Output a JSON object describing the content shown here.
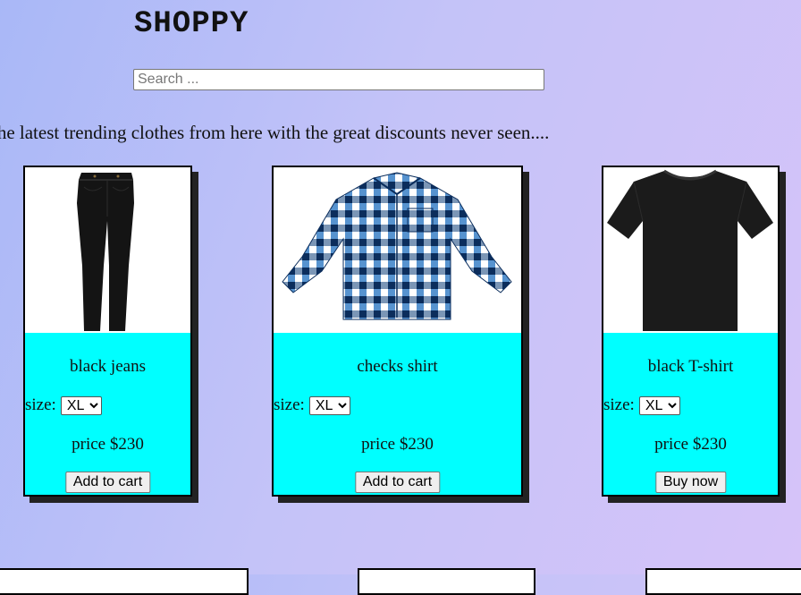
{
  "header": {
    "brand": "SHOPPY",
    "search_placeholder": "Search ...",
    "tagline": "the latest trending clothes from here with the great discounts never seen...."
  },
  "products": [
    {
      "name": "black jeans",
      "size_label": "size:",
      "size_options": [
        "XL"
      ],
      "size_selected": "XL",
      "price": "price $230",
      "button_label": "Add to cart",
      "image_icon": "black-jeans-image"
    },
    {
      "name": "checks shirt",
      "size_label": "size:",
      "size_options": [
        "XL"
      ],
      "size_selected": "XL",
      "price": "price $230",
      "button_label": "Add to cart",
      "image_icon": "checks-shirt-image"
    },
    {
      "name": "black T-shirt",
      "size_label": "size:",
      "size_options": [
        "XL"
      ],
      "size_selected": "XL",
      "price": "price $230",
      "button_label": "Buy now",
      "image_icon": "black-tshirt-image"
    }
  ],
  "colors": {
    "card_info_bg": "#00ffff",
    "card_border": "#000000"
  }
}
